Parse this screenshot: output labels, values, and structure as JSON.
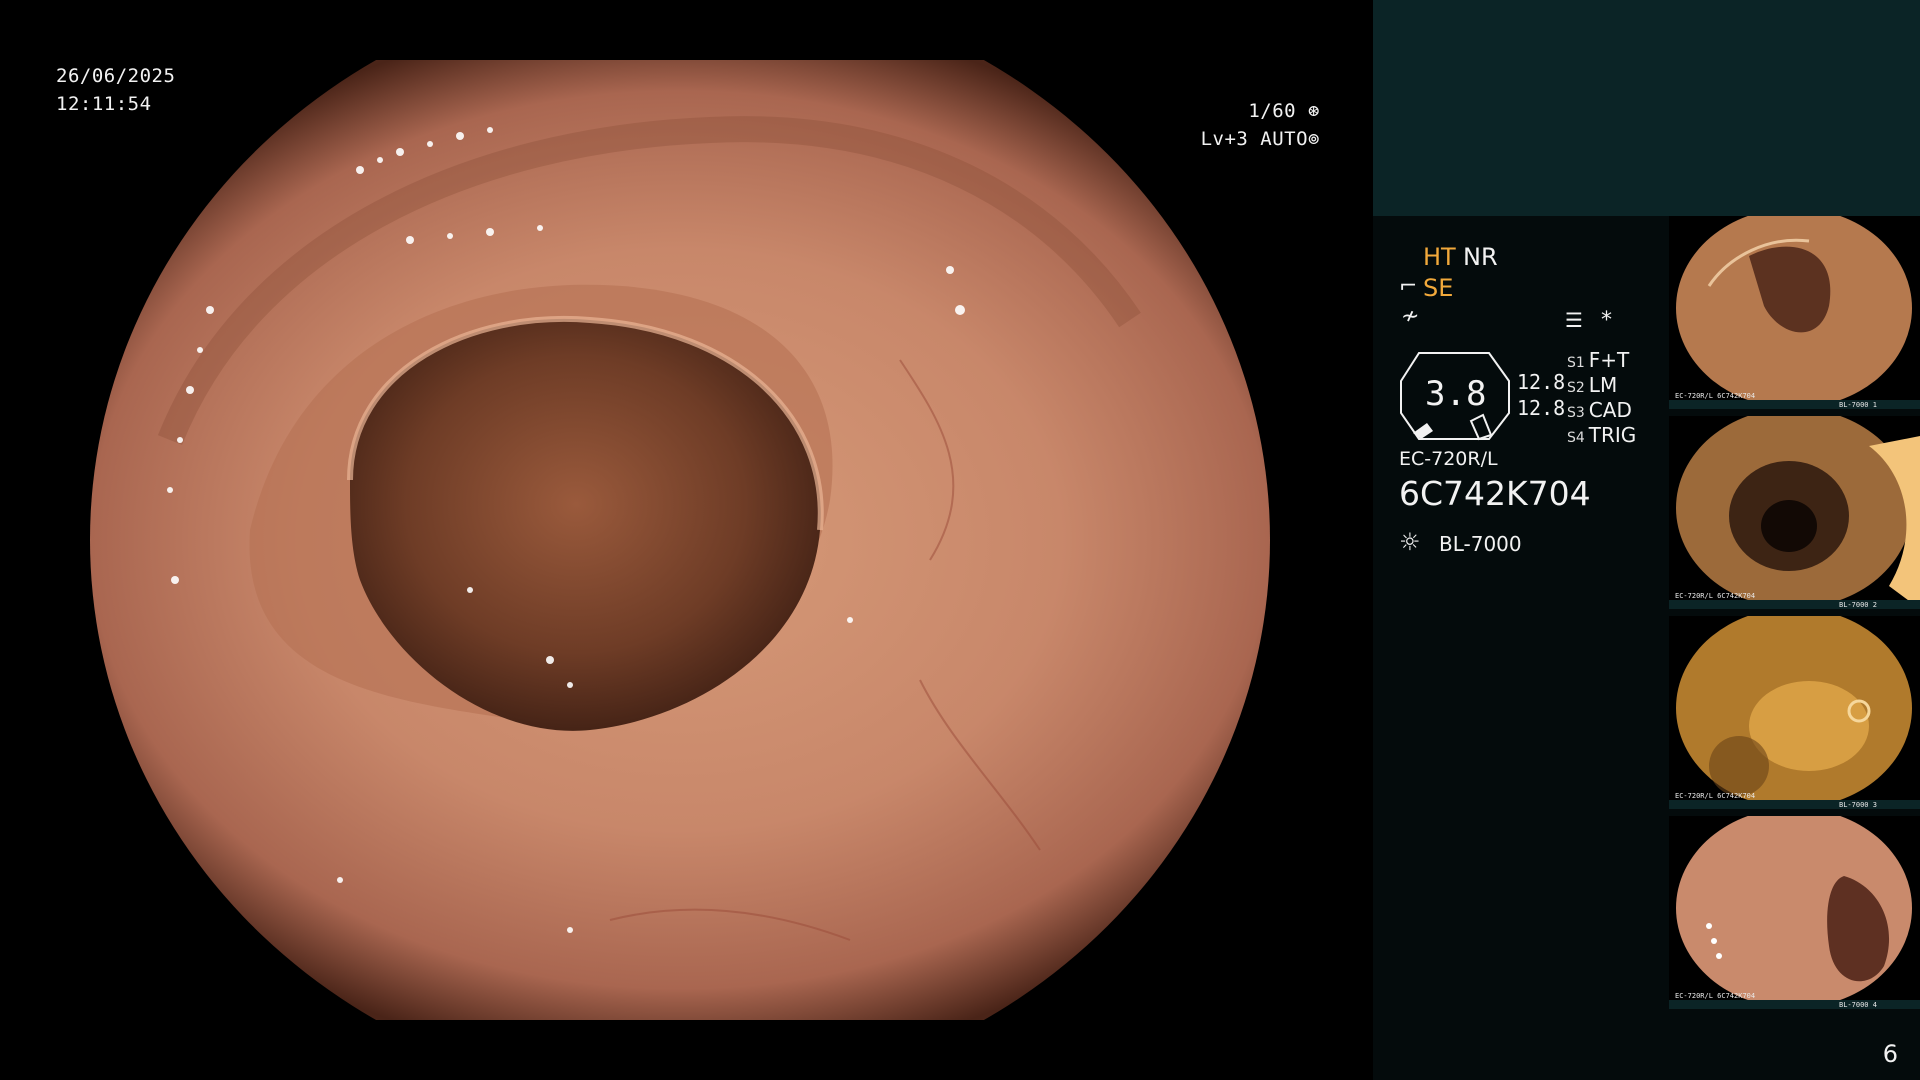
{
  "overlay": {
    "date": "26/06/2025",
    "time": "12:11:54",
    "shutter": "1/60",
    "level": "Lv+3",
    "mode": "AUTO"
  },
  "panel": {
    "ht": "HT",
    "nr": "NR",
    "se": "SE",
    "zoom_value": "3.8",
    "value_1": "12.8",
    "value_2": "12.8",
    "slots": [
      {
        "key": "S1",
        "value": "F+T"
      },
      {
        "key": "S2",
        "value": "LM"
      },
      {
        "key": "S3",
        "value": "CAD"
      },
      {
        "key": "S4",
        "value": "TRIG"
      }
    ],
    "scope_model": "EC-720R/L",
    "serial": "6C742K704",
    "light_source": "BL-7000"
  },
  "thumbnails": [
    {
      "id": "thumb-1",
      "scope": "EC-720R/L",
      "serial": "6C742K704",
      "source": "BL-7000",
      "index": "1"
    },
    {
      "id": "thumb-2",
      "scope": "EC-720R/L",
      "serial": "6C742K704",
      "source": "BL-7000",
      "index": "2"
    },
    {
      "id": "thumb-3",
      "scope": "EC-720R/L",
      "serial": "6C742K704",
      "source": "BL-7000",
      "index": "3"
    },
    {
      "id": "thumb-4",
      "scope": "EC-720R/L",
      "serial": "6C742K704",
      "source": "BL-7000",
      "index": "4"
    }
  ],
  "page": {
    "number": "6"
  },
  "colors": {
    "orange_label": "#f2a93b",
    "panel_teal": "#0b2426",
    "panel_dark": "#040b0c",
    "mucosa": "#c98a68"
  },
  "icons": [
    "aperture-icon",
    "iris-icon",
    "scope-icon",
    "enhance-icon",
    "menu-icon",
    "asterisk-icon",
    "lamp-icon"
  ]
}
